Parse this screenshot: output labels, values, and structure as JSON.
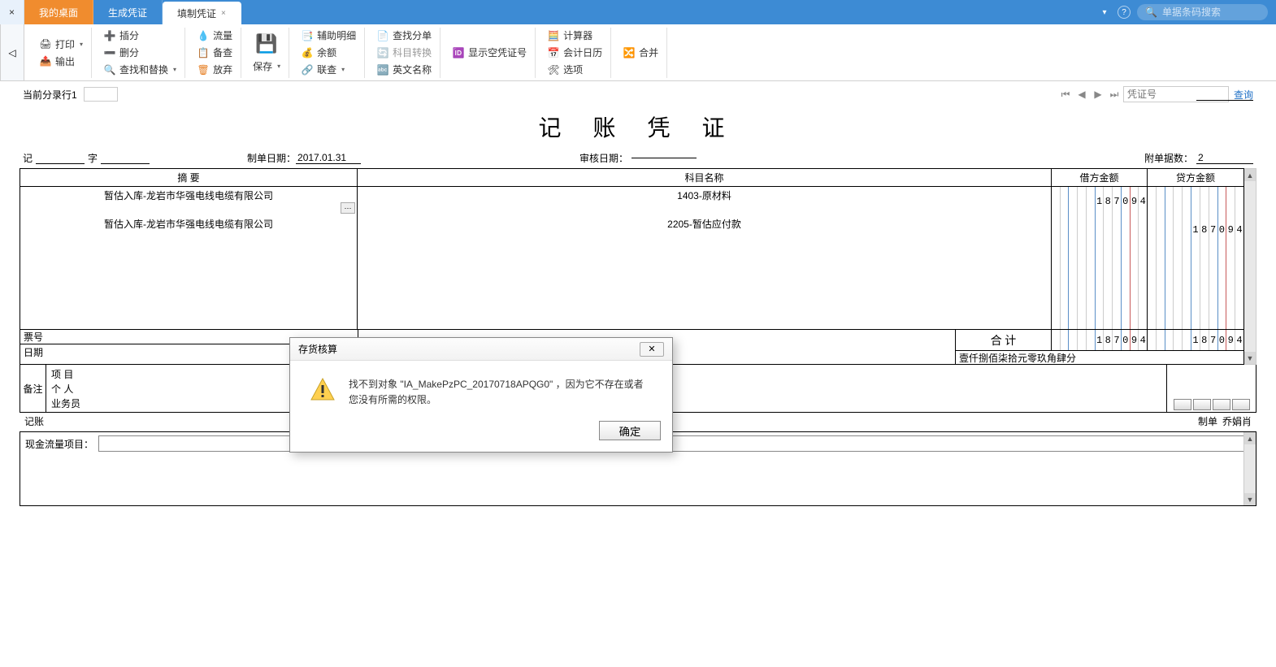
{
  "topbar": {
    "tabs": [
      {
        "label": "我的桌面",
        "kind": "desktop"
      },
      {
        "label": "生成凭证"
      },
      {
        "label": "填制凭证",
        "active": true
      }
    ],
    "search_placeholder": "单据条码搜索",
    "help": "?"
  },
  "ribbon": {
    "print": "打印",
    "output": "输出",
    "insert_split": "插分",
    "delete_split": "删分",
    "find_replace": "查找和替换",
    "flow": "流量",
    "audit": "备查",
    "abandon": "放弃",
    "save": "保存",
    "aux_detail": "辅助明细",
    "balance": "余额",
    "linked_check": "联查",
    "find_split": "查找分单",
    "subject_convert": "科目转换",
    "english_name": "英文名称",
    "show_empty_no": "显示空凭证号",
    "calculator": "计算器",
    "acct_calendar": "会计日历",
    "options": "选项",
    "merge": "合并"
  },
  "doc": {
    "current_entry_label": "当前分录行1",
    "voucher_no_placeholder": "凭证号",
    "query": "查询",
    "title": "记 账 凭 证",
    "ji": "记",
    "zi": "字",
    "make_date_label": "制单日期：",
    "make_date": "2017.01.31",
    "audit_date_label": "审核日期：",
    "attach_label": "附单据数：",
    "attach_count": "2",
    "headers": {
      "abstract": "摘 要",
      "subject": "科目名称",
      "debit": "借方金额",
      "credit": "贷方金额"
    },
    "rows": [
      {
        "abstract": "暂估入库-龙岩市华强电线电缆有限公司",
        "subject": "1403-原材料",
        "debit": "187094",
        "credit": ""
      },
      {
        "abstract": "暂估入库-龙岩市华强电线电缆有限公司",
        "subject": "2205-暂估应付款",
        "debit": "",
        "credit": "187094"
      }
    ],
    "ticket_no": "票号",
    "date_label": "日期",
    "total_label": "合 计",
    "total_debit": "187094",
    "total_credit": "187094",
    "cn_amount": "壹仟捌佰柒拾元零玖角肆分",
    "notes_label": "备注",
    "note_rows": [
      "项 目",
      "个 人",
      "业务员"
    ],
    "posting": "记账",
    "maker_label": "制单",
    "maker": "乔娟肖",
    "cashflow_label": "现金流量项目："
  },
  "modal": {
    "title": "存货核算",
    "message": "找不到对象 \"IA_MakePzPC_20170718APQG0\" ，因为它不存在或者您没有所需的权限。",
    "ok": "确定"
  }
}
